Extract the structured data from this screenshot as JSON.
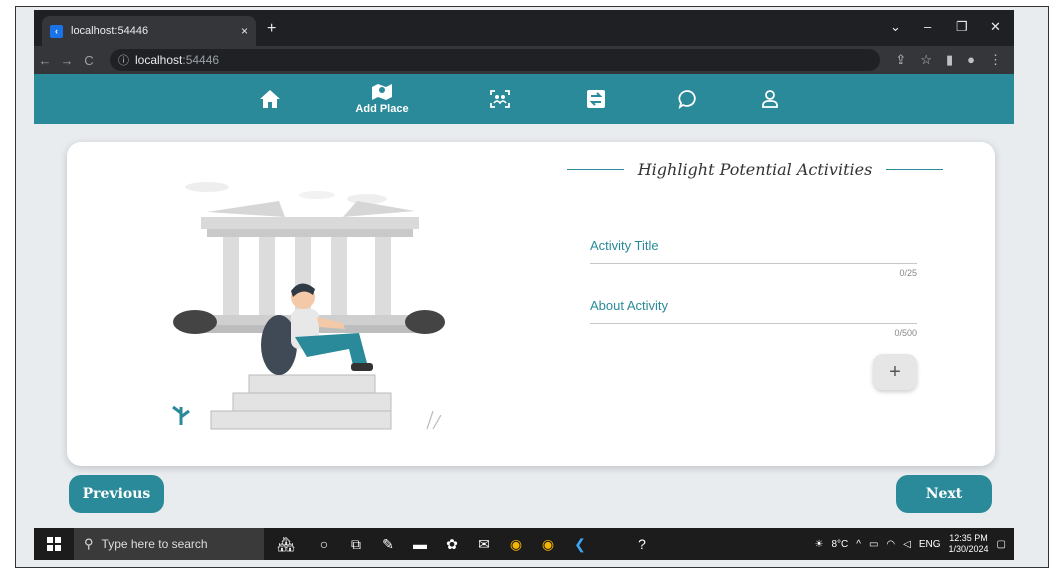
{
  "browser": {
    "tab_title": "localhost:54446",
    "tab_close": "×",
    "new_tab": "+",
    "url_host": "localhost",
    "url_port": ":54446"
  },
  "app_nav": {
    "add_place_label": "Add Place"
  },
  "form": {
    "section_title": "Highlight Potential Activities",
    "activity_title_label": "Activity Title",
    "activity_title_count": "0/25",
    "about_activity_label": "About Activity",
    "about_activity_count": "0/500",
    "add_button": "+"
  },
  "buttons": {
    "previous": "Previous",
    "next": "Next"
  },
  "taskbar": {
    "search_placeholder": "Type here to search",
    "temperature": "8°C",
    "language": "ENG",
    "time": "12:35 PM",
    "date": "1/30/2024"
  },
  "colors": {
    "brand": "#2a8a99",
    "card_bg": "#ffffff"
  }
}
